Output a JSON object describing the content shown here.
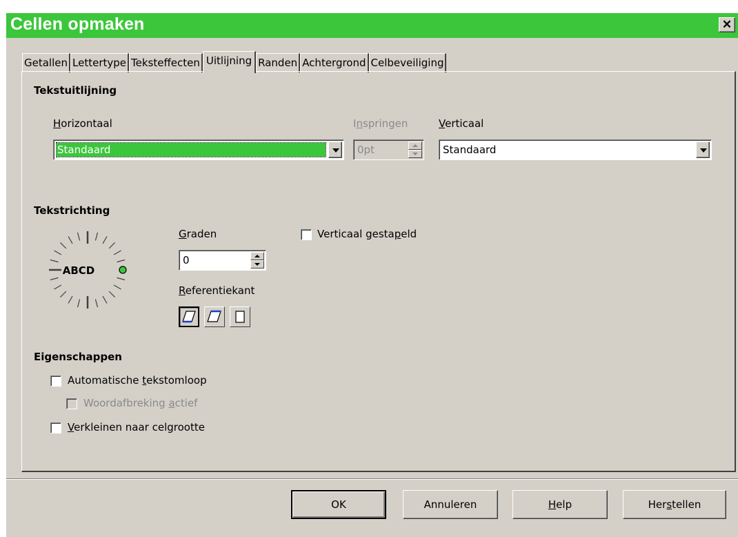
{
  "window": {
    "title": "Cellen opmaken",
    "close_glyph": "✕"
  },
  "tabs": [
    {
      "label": "Getallen"
    },
    {
      "label": "Lettertype"
    },
    {
      "label": "Teksteffecten"
    },
    {
      "label": "Uitlijning",
      "active": true
    },
    {
      "label": "Randen"
    },
    {
      "label": "Achtergrond"
    },
    {
      "label": "Celbeveiliging"
    }
  ],
  "text_alignment": {
    "heading": "Tekstuitlijning",
    "horizontal": {
      "label_first": "H",
      "label_rest": "orizontaal",
      "value": "Standaard"
    },
    "indent": {
      "label_pre": "I",
      "label_u": "n",
      "label_post": "springen",
      "value": "0pt",
      "enabled": false
    },
    "vertical": {
      "label_first": "V",
      "label_rest": "erticaal",
      "value": "Standaard"
    }
  },
  "text_orientation": {
    "heading": "Tekstrichting",
    "dial_text": "ABCD",
    "degrees": {
      "label_first": "G",
      "label_rest": "raden",
      "value": "0"
    },
    "reference_edge": {
      "label_first": "R",
      "label_rest": "eferentiekant",
      "active_index": 0
    },
    "vertically_stacked": {
      "label_pre": "Verticaal gesta",
      "label_u": "p",
      "label_post": "eld",
      "checked": false
    }
  },
  "properties": {
    "heading": "Eigenschappen",
    "wrap": {
      "label_pre": "Automatische ",
      "label_u": "t",
      "label_post": "ekstomloop",
      "checked": false
    },
    "hyphenation": {
      "label_pre": "Woordafbreking ",
      "label_u": "a",
      "label_post": "ctief",
      "checked": false,
      "enabled": false
    },
    "shrink": {
      "label_pre": "",
      "label_u": "V",
      "label_post": "erkleinen naar celgrootte",
      "checked": false
    }
  },
  "buttons": {
    "ok": "OK",
    "cancel": "Annuleren",
    "help_u": "H",
    "help_rest": "elp",
    "reset_pre": "Her",
    "reset_u": "s",
    "reset_post": "tellen"
  },
  "colors": {
    "accent": "#3cc63c",
    "dialog_bg": "#d4d0c8",
    "dial_indicator": "#3cc63c"
  }
}
